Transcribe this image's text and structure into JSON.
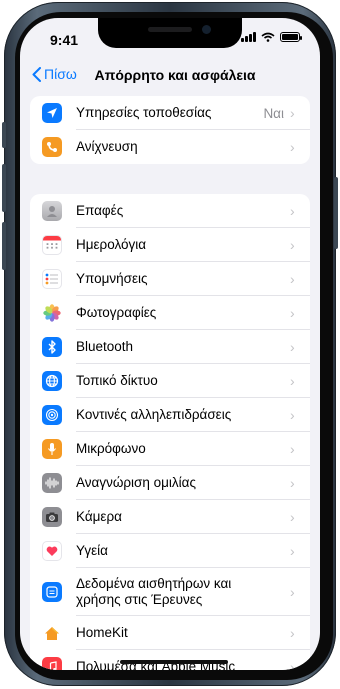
{
  "status": {
    "time": "9:41"
  },
  "nav": {
    "back_label": "Πίσω",
    "title": "Απόρρητο και ασφάλεια"
  },
  "group1": [
    {
      "label": "Υπηρεσίες τοποθεσίας",
      "value": "Ναι",
      "icon": "location-arrow-icon",
      "color": "#0a7aff"
    },
    {
      "label": "Ανίχνευση",
      "value": "",
      "icon": "tracking-icon",
      "color": "#f59a23"
    }
  ],
  "group2": [
    {
      "label": "Επαφές",
      "icon": "contacts-icon",
      "color": "#b9b9bd"
    },
    {
      "label": "Ημερολόγια",
      "icon": "calendar-icon",
      "color": "#ffffff"
    },
    {
      "label": "Υπομνήσεις",
      "icon": "reminders-icon",
      "color": "#ffffff"
    },
    {
      "label": "Φωτογραφίες",
      "icon": "photos-icon",
      "color": "#ffffff"
    },
    {
      "label": "Bluetooth",
      "icon": "bluetooth-icon",
      "color": "#0a7aff"
    },
    {
      "label": "Τοπικό δίκτυο",
      "icon": "globe-icon",
      "color": "#0a7aff"
    },
    {
      "label": "Κοντινές αλληλεπιδράσεις",
      "icon": "nearby-icon",
      "color": "#0a7aff"
    },
    {
      "label": "Μικρόφωνο",
      "icon": "microphone-icon",
      "color": "#f59a23"
    },
    {
      "label": "Αναγνώριση ομιλίας",
      "icon": "waveform-icon",
      "color": "#8e8e93"
    },
    {
      "label": "Κάμερα",
      "icon": "camera-icon",
      "color": "#8e8e93"
    },
    {
      "label": "Υγεία",
      "icon": "heart-icon",
      "color": "#ffffff"
    },
    {
      "label": "Δεδομένα αισθητήρων και χρήσης στις Έρευνες",
      "icon": "research-icon",
      "color": "#0a7aff"
    },
    {
      "label": "HomeKit",
      "icon": "home-icon",
      "color": "#ffffff"
    },
    {
      "label": "Πολυμέσα και Apple Music",
      "icon": "music-icon",
      "color": "#fc3c44"
    }
  ]
}
